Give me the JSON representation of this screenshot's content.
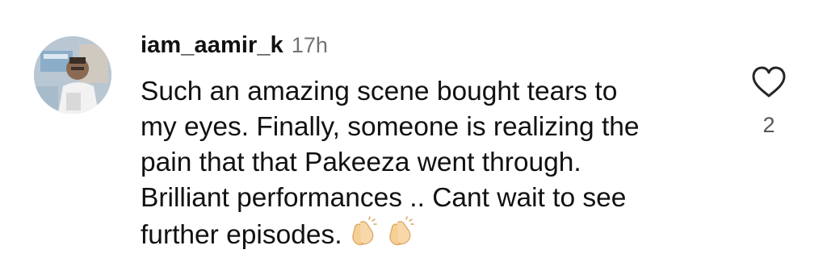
{
  "comment": {
    "username": "iam_aamir_k",
    "timestamp": "17h",
    "text_lines": [
      "Such an amazing scene bought tears to",
      "my eyes. Finally, someone is realizing the",
      "pain that that Pakeeza went through.",
      "Brilliant performances .. Cant wait to see",
      "further episodes."
    ],
    "emojis": [
      "clapping-hands",
      "clapping-hands"
    ],
    "like_count": "2"
  },
  "icons": {
    "like": "heart-outline-icon",
    "avatar": "user-avatar"
  },
  "colors": {
    "text": "#111111",
    "timestamp": "#737373",
    "like_count": "#555555",
    "heart_stroke": "#262626"
  }
}
